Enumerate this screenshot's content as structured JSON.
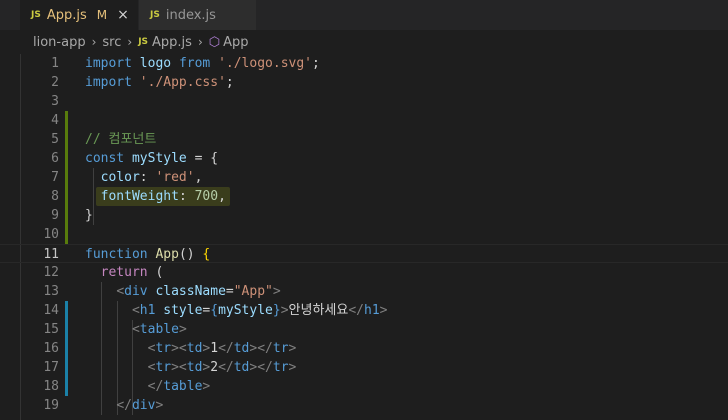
{
  "tabs": [
    {
      "icon": "JS",
      "label": "App.js",
      "modified": "M",
      "close": "×"
    },
    {
      "icon": "JS",
      "label": "index.js"
    }
  ],
  "breadcrumb": {
    "items": [
      "lion-app",
      "src",
      "App.js",
      "App"
    ],
    "file_icon": "JS"
  },
  "colors": {
    "background": "#1e1e1e",
    "added_line_marker": "#587c0c",
    "modified_line_marker": "#1b81a8"
  },
  "editor": {
    "current_line": 11,
    "lines": [
      {
        "num": "1",
        "tokens": [
          [
            "kb",
            "import"
          ],
          [
            "p",
            " "
          ],
          [
            "v",
            "logo"
          ],
          [
            "p",
            " "
          ],
          [
            "kb",
            "from"
          ],
          [
            "p",
            " "
          ],
          [
            "s",
            "'./logo.svg'"
          ],
          [
            "p",
            ";"
          ]
        ]
      },
      {
        "num": "2",
        "tokens": [
          [
            "kb",
            "import"
          ],
          [
            "p",
            " "
          ],
          [
            "s",
            "'./App.css'"
          ],
          [
            "p",
            ";"
          ]
        ]
      },
      {
        "num": "3",
        "tokens": []
      },
      {
        "num": "4",
        "tokens": []
      },
      {
        "num": "5",
        "tokens": [
          [
            "c",
            "// 컴포넌트"
          ]
        ]
      },
      {
        "num": "6",
        "tokens": [
          [
            "kb",
            "const"
          ],
          [
            "p",
            " "
          ],
          [
            "v",
            "myStyle"
          ],
          [
            "p",
            " = "
          ],
          [
            "p",
            "{"
          ]
        ]
      },
      {
        "num": "7",
        "tokens": [
          [
            "p",
            "  "
          ],
          [
            "v",
            "color"
          ],
          [
            "p",
            ": "
          ],
          [
            "s",
            "'red'"
          ],
          [
            "p",
            ","
          ]
        ]
      },
      {
        "num": "8",
        "tokens": [
          [
            "p",
            "  "
          ],
          [
            "v",
            "fontWeight"
          ],
          [
            "p",
            ": "
          ],
          [
            "n",
            "700"
          ],
          [
            "p",
            ","
          ]
        ]
      },
      {
        "num": "9",
        "tokens": [
          [
            "p",
            "}"
          ]
        ]
      },
      {
        "num": "10",
        "tokens": []
      },
      {
        "num": "11",
        "tokens": [
          [
            "kb",
            "function"
          ],
          [
            "p",
            " "
          ],
          [
            "f",
            "App"
          ],
          [
            "p",
            "() "
          ],
          [
            "p",
            "{"
          ]
        ]
      },
      {
        "num": "12",
        "tokens": [
          [
            "p",
            "  "
          ],
          [
            "k",
            "return"
          ],
          [
            "p",
            " "
          ],
          [
            "p",
            "("
          ]
        ]
      },
      {
        "num": "13",
        "tokens": [
          [
            "p",
            "    "
          ],
          [
            "tg",
            "<"
          ],
          [
            "t",
            "div"
          ],
          [
            "p",
            " "
          ],
          [
            "v",
            "className"
          ],
          [
            "p",
            "="
          ],
          [
            "s",
            "\"App\""
          ],
          [
            "tg",
            ">"
          ]
        ]
      },
      {
        "num": "14",
        "tokens": [
          [
            "p",
            "      "
          ],
          [
            "tg",
            "<"
          ],
          [
            "t",
            "h1"
          ],
          [
            "p",
            " "
          ],
          [
            "v",
            "style"
          ],
          [
            "p",
            "="
          ],
          [
            "kb",
            "{"
          ],
          [
            "v",
            "myStyle"
          ],
          [
            "kb",
            "}"
          ],
          [
            "tg",
            ">"
          ],
          [
            "p",
            "안녕하세요"
          ],
          [
            "tg",
            "</"
          ],
          [
            "t",
            "h1"
          ],
          [
            "tg",
            ">"
          ]
        ]
      },
      {
        "num": "15",
        "tokens": [
          [
            "p",
            "      "
          ],
          [
            "tg",
            "<"
          ],
          [
            "t",
            "table"
          ],
          [
            "tg",
            ">"
          ]
        ]
      },
      {
        "num": "16",
        "tokens": [
          [
            "p",
            "        "
          ],
          [
            "tg",
            "<"
          ],
          [
            "t",
            "tr"
          ],
          [
            "tg",
            "><"
          ],
          [
            "t",
            "td"
          ],
          [
            "tg",
            ">"
          ],
          [
            "p",
            "1"
          ],
          [
            "tg",
            "</"
          ],
          [
            "t",
            "td"
          ],
          [
            "tg",
            "></"
          ],
          [
            "t",
            "tr"
          ],
          [
            "tg",
            ">"
          ]
        ]
      },
      {
        "num": "17",
        "tokens": [
          [
            "p",
            "        "
          ],
          [
            "tg",
            "<"
          ],
          [
            "t",
            "tr"
          ],
          [
            "tg",
            "><"
          ],
          [
            "t",
            "td"
          ],
          [
            "tg",
            ">"
          ],
          [
            "p",
            "2"
          ],
          [
            "tg",
            "</"
          ],
          [
            "t",
            "td"
          ],
          [
            "tg",
            "></"
          ],
          [
            "t",
            "tr"
          ],
          [
            "tg",
            ">"
          ]
        ]
      },
      {
        "num": "18",
        "tokens": [
          [
            "p",
            "        "
          ],
          [
            "tg",
            "</"
          ],
          [
            "t",
            "table"
          ],
          [
            "tg",
            ">"
          ]
        ]
      },
      {
        "num": "19",
        "tokens": [
          [
            "p",
            "    "
          ],
          [
            "tg",
            "</"
          ],
          [
            "t",
            "div"
          ],
          [
            "tg",
            ">"
          ]
        ]
      }
    ]
  }
}
